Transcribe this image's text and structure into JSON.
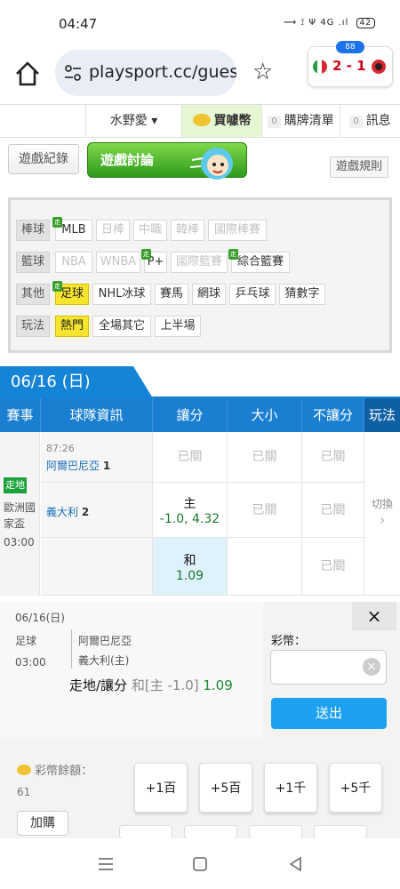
{
  "status": {
    "time": "04:47",
    "icons_text": "⟿ ⟟ Ψ 4G .ıl",
    "battery": "42"
  },
  "browser": {
    "url": "playsport.cc/gues"
  },
  "score_widget": {
    "badge": "88",
    "score": "2 - 1"
  },
  "account": {
    "user": "水野愛 ▾",
    "buy_coin": "買噱幣",
    "cart_count": "0",
    "cart_label": "購牌清單",
    "msg_count": "0",
    "msg_label": "訊息"
  },
  "tabs": {
    "record": "遊戲紀錄",
    "forum": "遊戲討論",
    "rules": "遊戲規則"
  },
  "filters": {
    "baseball": {
      "label": "棒球",
      "items": [
        "MLB",
        "日棒",
        "中職",
        "韓棒",
        "國際棒賽"
      ]
    },
    "basketball": {
      "label": "籃球",
      "items": [
        "NBA",
        "WNBA",
        "P+",
        "國際籃賽",
        "綜合籃賽"
      ]
    },
    "other": {
      "label": "其他",
      "items": [
        "足球",
        "NHL冰球",
        "賽馬",
        "網球",
        "乒乓球",
        "猜數字"
      ]
    },
    "play": {
      "label": "玩法",
      "items": [
        "熱門",
        "全場其它",
        "上半場"
      ]
    }
  },
  "date": "06/16 (日)",
  "table": {
    "headers": [
      "賽事",
      "球隊資訊",
      "讓分",
      "大小",
      "不讓分",
      "玩法"
    ],
    "event": {
      "walk": "走地",
      "name": "歐洲國家盃",
      "time": "03:00"
    },
    "time_elapsed": "87:26",
    "team1": "阿爾巴尼亞",
    "team1_score": "1",
    "team2": "義大利",
    "team2_score": "2",
    "closed": "已關",
    "home_label": "主",
    "home_odds": "-1.0, 4.32",
    "draw_label": "和",
    "draw_odds": "1.09",
    "switch": "切換"
  },
  "slip": {
    "date": "06/16(日)",
    "sport": "足球",
    "time": "03:00",
    "team1": "阿爾巴尼亞",
    "team2": "義大利(主)",
    "bet_prefix": "走地/讓分",
    "bet_line": "和[主 -1.0]",
    "bet_odds": "1.09",
    "coin_label": "彩幣：",
    "submit": "送出",
    "close": "×",
    "balance_label": "彩幣餘額：",
    "balance": "61",
    "buy_more": "加購",
    "amounts": [
      "+1百",
      "+5百",
      "+1千",
      "+5千"
    ]
  }
}
